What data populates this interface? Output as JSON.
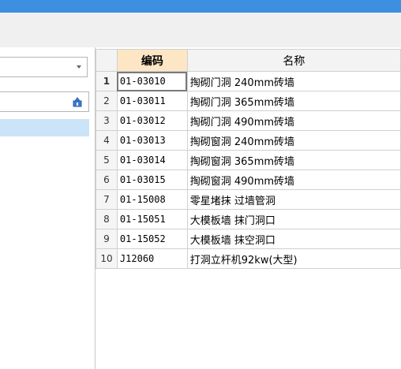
{
  "header": {
    "title_bar_color": "#3d8fe0"
  },
  "left_panel": {
    "combo_value": "",
    "search_value": "",
    "icons": {
      "dropdown": "chevron-down-icon",
      "search": "filter-icon"
    }
  },
  "grid": {
    "columns": [
      "编码",
      "名称"
    ],
    "rows": [
      {
        "num": "1",
        "code": "01-03010",
        "name": "掏砌门洞 240mm砖墙"
      },
      {
        "num": "2",
        "code": "01-03011",
        "name": "掏砌门洞 365mm砖墙"
      },
      {
        "num": "3",
        "code": "01-03012",
        "name": "掏砌门洞 490mm砖墙"
      },
      {
        "num": "4",
        "code": "01-03013",
        "name": "掏砌窗洞 240mm砖墙"
      },
      {
        "num": "5",
        "code": "01-03014",
        "name": "掏砌窗洞 365mm砖墙"
      },
      {
        "num": "6",
        "code": "01-03015",
        "name": "掏砌窗洞 490mm砖墙"
      },
      {
        "num": "7",
        "code": "01-15008",
        "name": "零星堵抹 过墙管洞"
      },
      {
        "num": "8",
        "code": "01-15051",
        "name": "大模板墙 抹门洞口"
      },
      {
        "num": "9",
        "code": "01-15052",
        "name": "大模板墙 抹空洞口"
      },
      {
        "num": "10",
        "code": "J12060",
        "name": "打洞立杆机92kw(大型)"
      }
    ]
  }
}
